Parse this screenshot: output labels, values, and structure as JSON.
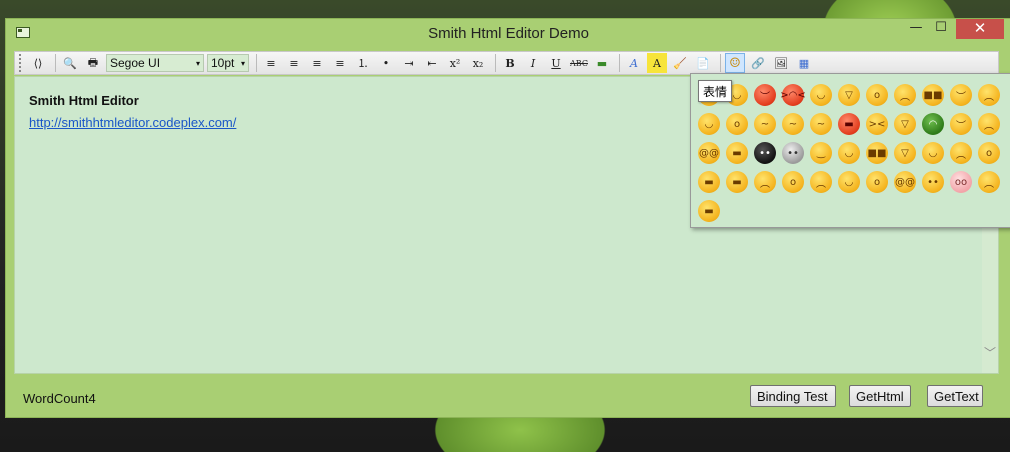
{
  "window": {
    "title": "Smith Html Editor Demo",
    "min_glyph": "—",
    "max_glyph": "☐",
    "close_glyph": "✕"
  },
  "toolbar": {
    "font_name": "Segoe UI",
    "font_size": "10pt",
    "dropdown_arrow": "▾",
    "buttons": [
      {
        "icon": "source-view-icon",
        "glyph": "⟨⟩"
      },
      {
        "icon": "print-preview-icon",
        "glyph": "🔍"
      },
      {
        "icon": "print-icon",
        "glyph": "🖶"
      },
      {
        "icon": "align-left-icon",
        "glyph": "≡"
      },
      {
        "icon": "align-center-icon",
        "glyph": "≡"
      },
      {
        "icon": "align-right-icon",
        "glyph": "≡"
      },
      {
        "icon": "justify-icon",
        "glyph": "≡"
      },
      {
        "icon": "numbered-list-icon",
        "glyph": "⒈"
      },
      {
        "icon": "bullet-list-icon",
        "glyph": "•"
      },
      {
        "icon": "indent-icon",
        "glyph": "⇥"
      },
      {
        "icon": "outdent-icon",
        "glyph": "⇤"
      },
      {
        "icon": "superscript-icon",
        "glyph": "x²"
      },
      {
        "icon": "subscript-icon",
        "glyph": "x₂"
      },
      {
        "icon": "bold-icon",
        "glyph": "B"
      },
      {
        "icon": "italic-icon",
        "glyph": "I"
      },
      {
        "icon": "underline-icon",
        "glyph": "U"
      },
      {
        "icon": "strikethrough-icon",
        "glyph": "ABC"
      },
      {
        "icon": "horizontal-line-icon",
        "glyph": "▬"
      },
      {
        "icon": "font-color-icon",
        "glyph": "A"
      },
      {
        "icon": "highlight-color-icon",
        "glyph": "A"
      },
      {
        "icon": "clear-format-icon",
        "glyph": "🧹"
      },
      {
        "icon": "paste-text-icon",
        "glyph": "📄"
      },
      {
        "icon": "emoticon-icon",
        "glyph": "☺"
      },
      {
        "icon": "hyperlink-icon",
        "glyph": "🔗"
      },
      {
        "icon": "insert-image-icon",
        "glyph": "🖼"
      },
      {
        "icon": "insert-table-icon",
        "glyph": "▦"
      }
    ]
  },
  "editor": {
    "heading": "Smith Html Editor",
    "link": "http://smithhtmleditor.codeplex.com/",
    "scroll_down_glyph": "﹀"
  },
  "status": {
    "word_count": "WordCount4"
  },
  "buttons": {
    "binding_test": "Binding Test",
    "get_html": "GetHtml",
    "get_text": "GetText"
  },
  "emoticon_popup": {
    "tooltip": "表情",
    "emoticons": [
      {
        "style": "default",
        "glyph": "•◡•"
      },
      {
        "style": "default",
        "glyph": "◡"
      },
      {
        "style": "red",
        "glyph": "︶"
      },
      {
        "style": "red",
        "glyph": ">◠<"
      },
      {
        "style": "default",
        "glyph": "◡"
      },
      {
        "style": "default",
        "glyph": "▽"
      },
      {
        "style": "default",
        "glyph": "o"
      },
      {
        "style": "default",
        "glyph": "︵"
      },
      {
        "style": "default",
        "glyph": "■■"
      },
      {
        "style": "default",
        "glyph": "︶"
      },
      {
        "style": "default",
        "glyph": "︵"
      },
      {
        "style": "default",
        "glyph": "◡"
      },
      {
        "style": "default",
        "glyph": "o"
      },
      {
        "style": "default",
        "glyph": "~"
      },
      {
        "style": "default",
        "glyph": "~"
      },
      {
        "style": "default",
        "glyph": "~"
      },
      {
        "style": "red",
        "glyph": "▬"
      },
      {
        "style": "default",
        "glyph": "><"
      },
      {
        "style": "default",
        "glyph": "▽"
      },
      {
        "style": "green",
        "glyph": "◠"
      },
      {
        "style": "default",
        "glyph": "︶"
      },
      {
        "style": "default",
        "glyph": "︵"
      },
      {
        "style": "default",
        "glyph": "@@"
      },
      {
        "style": "default",
        "glyph": "▬"
      },
      {
        "style": "dark",
        "glyph": "••"
      },
      {
        "style": "grey",
        "glyph": "••"
      },
      {
        "style": "default",
        "glyph": "‿"
      },
      {
        "style": "default",
        "glyph": "◡"
      },
      {
        "style": "default",
        "glyph": "■■"
      },
      {
        "style": "default",
        "glyph": "▽"
      },
      {
        "style": "default",
        "glyph": "◡"
      },
      {
        "style": "default",
        "glyph": "︵"
      },
      {
        "style": "default",
        "glyph": "o"
      },
      {
        "style": "default",
        "glyph": "▬"
      },
      {
        "style": "default",
        "glyph": "▬"
      },
      {
        "style": "default",
        "glyph": "︵"
      },
      {
        "style": "default",
        "glyph": "o"
      },
      {
        "style": "default",
        "glyph": "︵"
      },
      {
        "style": "default",
        "glyph": "◡"
      },
      {
        "style": "default",
        "glyph": "o"
      },
      {
        "style": "default",
        "glyph": "@@"
      },
      {
        "style": "default",
        "glyph": "••"
      },
      {
        "style": "pig",
        "glyph": "oo"
      },
      {
        "style": "default",
        "glyph": "︵"
      },
      {
        "style": "default",
        "glyph": "▬"
      }
    ]
  }
}
